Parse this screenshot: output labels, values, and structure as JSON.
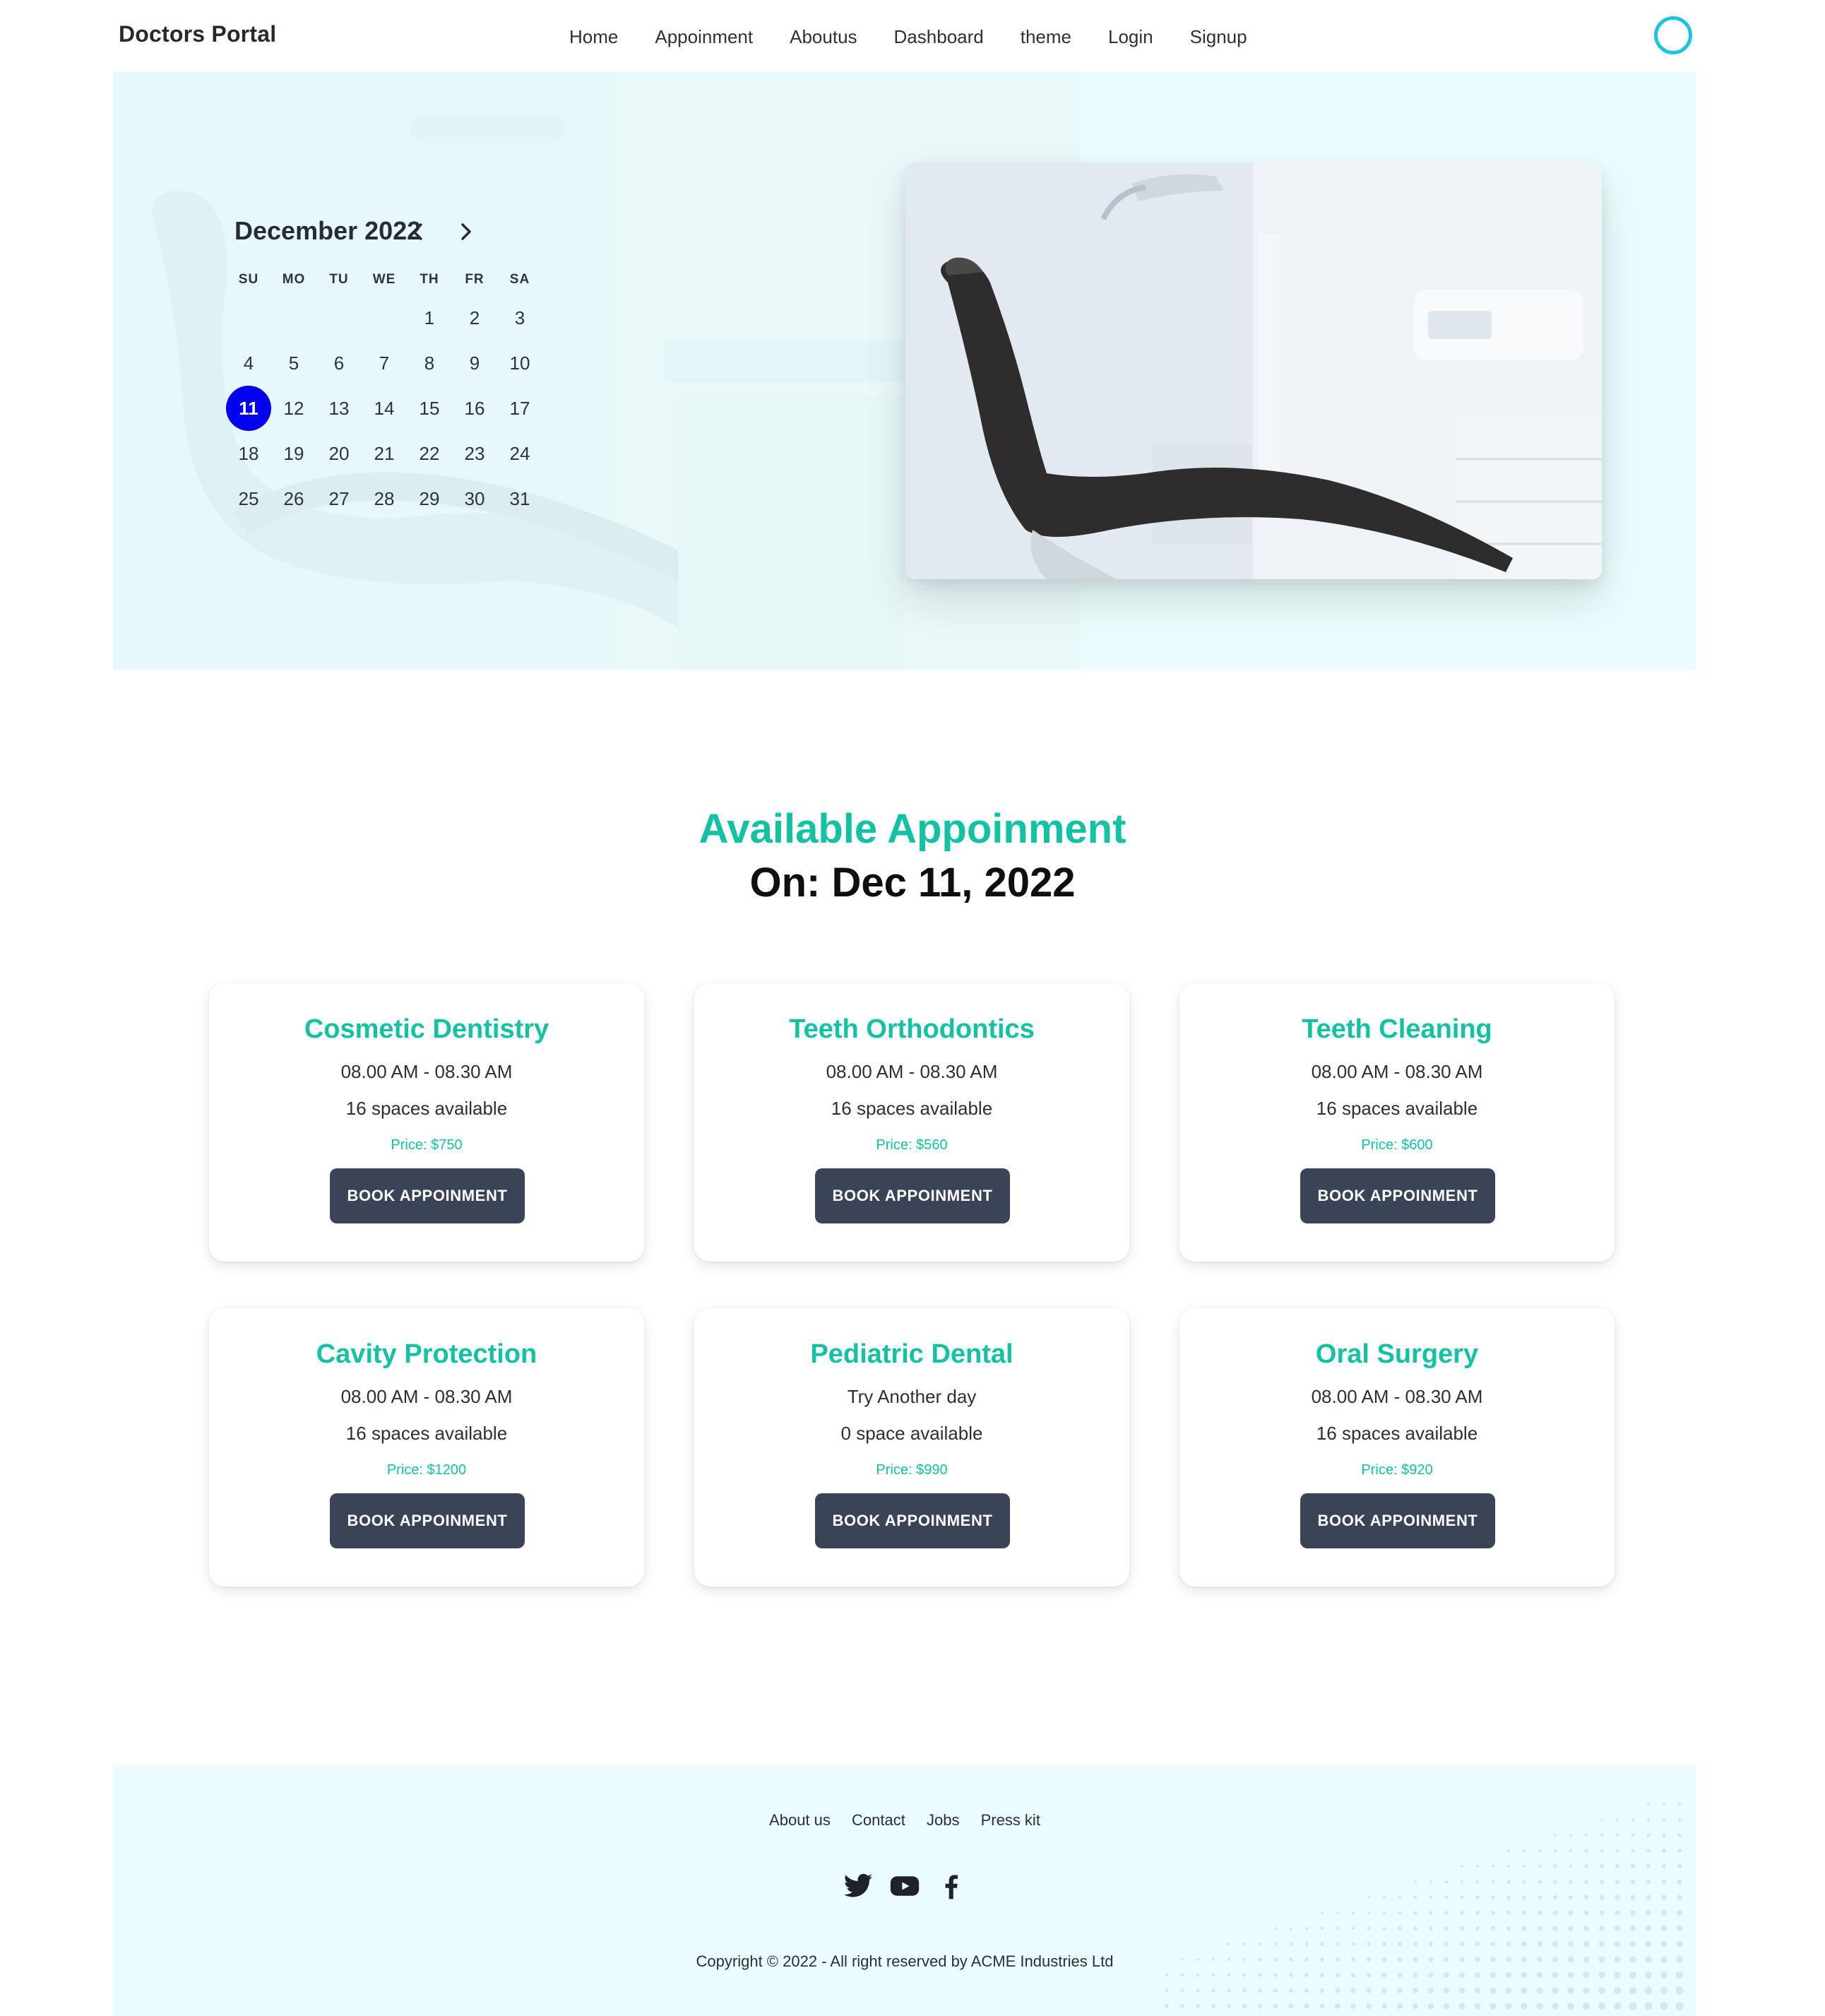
{
  "navbar": {
    "brand": "Doctors Portal",
    "menu": [
      {
        "label": "Home"
      },
      {
        "label": "Appoinment"
      },
      {
        "label": "Aboutus"
      },
      {
        "label": "Dashboard"
      },
      {
        "label": "theme"
      },
      {
        "label": "Login"
      },
      {
        "label": "Signup"
      }
    ]
  },
  "calendar": {
    "month_label": "December 2022",
    "weekdays": [
      "SU",
      "MO",
      "TU",
      "WE",
      "TH",
      "FR",
      "SA"
    ],
    "selected_day": "11",
    "weeks": [
      [
        "",
        "",
        "",
        "",
        "1",
        "2",
        "3"
      ],
      [
        "4",
        "5",
        "6",
        "7",
        "8",
        "9",
        "10"
      ],
      [
        "11",
        "12",
        "13",
        "14",
        "15",
        "16",
        "17"
      ],
      [
        "18",
        "19",
        "20",
        "21",
        "22",
        "23",
        "24"
      ],
      [
        "25",
        "26",
        "27",
        "28",
        "29",
        "30",
        "31"
      ]
    ]
  },
  "appointments": {
    "heading": "Available Appoinment",
    "date_line": "On: Dec 11, 2022",
    "button_label": "BOOK APPOINMENT",
    "services": [
      {
        "name": "Cosmetic Dentistry",
        "time": "08.00 AM - 08.30 AM",
        "spaces": "16 spaces available",
        "price": "Price: $750"
      },
      {
        "name": "Teeth Orthodontics",
        "time": "08.00 AM - 08.30 AM",
        "spaces": "16 spaces available",
        "price": "Price: $560"
      },
      {
        "name": "Teeth Cleaning",
        "time": "08.00 AM - 08.30 AM",
        "spaces": "16 spaces available",
        "price": "Price: $600"
      },
      {
        "name": "Cavity Protection",
        "time": "08.00 AM - 08.30 AM",
        "spaces": "16 spaces available",
        "price": "Price: $1200"
      },
      {
        "name": "Pediatric Dental",
        "time": "Try Another day",
        "spaces": "0 space available",
        "price": "Price: $990"
      },
      {
        "name": "Oral Surgery",
        "time": "08.00 AM - 08.30 AM",
        "spaces": "16 spaces available",
        "price": "Price: $920"
      }
    ]
  },
  "footer": {
    "links": [
      "About us",
      "Contact",
      "Jobs",
      "Press kit"
    ],
    "social_icons": [
      "twitter-icon",
      "youtube-icon",
      "facebook-icon"
    ],
    "copyright": "Copyright © 2022 - All right reserved by ACME Industries Ltd"
  },
  "colors": {
    "accent": "#13c2a3",
    "selected_day": "#0202ee",
    "button": "#3a4456",
    "hero_bg": "#eafcfd",
    "theme_ring": "#1ec3e0"
  }
}
